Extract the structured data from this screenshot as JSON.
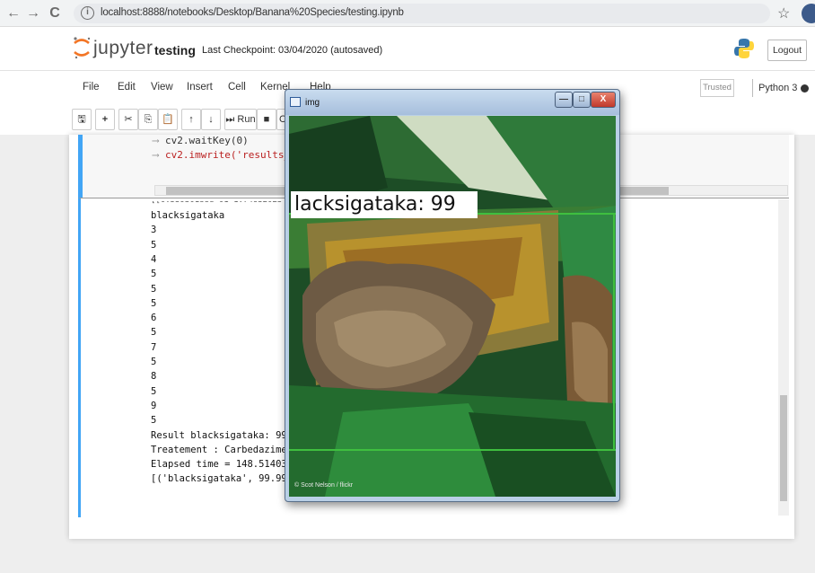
{
  "browser": {
    "back_icon": "←",
    "forward_icon": "→",
    "reload_icon": "C",
    "url": "localhost:8888/notebooks/Desktop/Banana%20Species/testing.ipynb",
    "star_icon": "☆"
  },
  "header": {
    "brand": "jupyter",
    "notebook_title": "testing",
    "checkpoint": "Last Checkpoint: 03/04/2020  (autosaved)",
    "logout_label": "Logout"
  },
  "menu": {
    "items": [
      "File",
      "Edit",
      "View",
      "Insert",
      "Cell",
      "Kernel",
      "Help"
    ],
    "trusted_label": "Trusted",
    "kernel_label": "Python 3"
  },
  "toolbar": {
    "buttons": [
      "🖫",
      "+",
      "✂",
      "⎘",
      "📋",
      "↑",
      "↓",
      "⏭ Run",
      "■",
      "C"
    ]
  },
  "cell": {
    "code_lines": [
      "cv2.waitKey(0)",
      "cv2.imwrite('results_im"
    ],
    "arrow": "⟶"
  },
  "output": {
    "partial_top": "[[0.55930188e-01 1.74632023",
    "lines": [
      "blacksigataka",
      "3",
      "5",
      "4",
      "5",
      "5",
      "5",
      "6",
      "5",
      "7",
      "5",
      "8",
      "5",
      "9",
      "5",
      "Result blacksigataka: 99",
      "Treatement : Carbedazime",
      "Elapsed time = 148.514030218",
      "[('blacksigataka', 99.99957084655762)]"
    ]
  },
  "image_window": {
    "title": "img",
    "prediction_label": "lacksigataka: 99",
    "watermark": "© Scot Nelson / flickr",
    "minimize_icon": "—",
    "maximize_icon": "□",
    "close_icon": "X"
  },
  "colors": {
    "cell_accent": "#42a5f5",
    "jupyter_orange": "#f37626",
    "box_green": "#3fbf3f"
  }
}
